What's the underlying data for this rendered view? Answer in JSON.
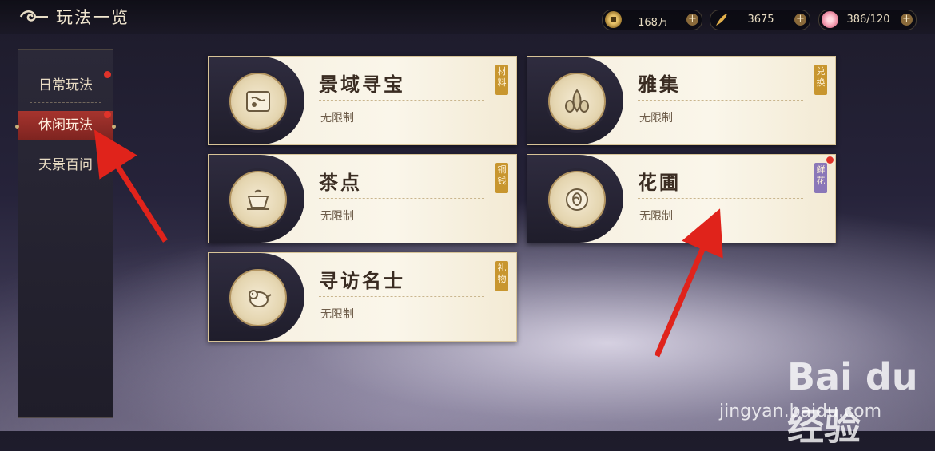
{
  "header": {
    "title": "玩法一览"
  },
  "resources": [
    {
      "icon": "coin-icon",
      "value": "168万"
    },
    {
      "icon": "feather-icon",
      "value": "3675"
    },
    {
      "icon": "flower-icon",
      "value": "386/120"
    }
  ],
  "sidebar": {
    "items": [
      {
        "label": "日常玩法",
        "has_dot": true
      },
      {
        "label": "休闲玩法",
        "selected": true,
        "has_dot": true
      },
      {
        "label": "天景百问"
      }
    ]
  },
  "cards": [
    {
      "name": "景域寻宝",
      "desc": "无限制",
      "tag": "材料",
      "icon": "scroll-map-icon"
    },
    {
      "name": "雅集",
      "desc": "无限制",
      "tag": "兑换",
      "icon": "vases-icon"
    },
    {
      "name": "茶点",
      "desc": "无限制",
      "tag": "铜钱",
      "icon": "teacup-icon"
    },
    {
      "name": "花圃",
      "desc": "无限制",
      "tag": "鲜花",
      "icon": "rose-icon",
      "has_dot": true
    },
    {
      "name": "寻访名士",
      "desc": "无限制",
      "tag": "礼物",
      "icon": "bird-icon"
    }
  ],
  "watermark": {
    "brand": "Bai du 经验",
    "url": "jingyan.baidu.com"
  },
  "colors": {
    "selected": "#a6342e",
    "card_bg": "#f6efdf",
    "tag_gold": "#c8962f",
    "tag_purple": "#8a77b8",
    "annotation_arrow": "#e0231b"
  }
}
